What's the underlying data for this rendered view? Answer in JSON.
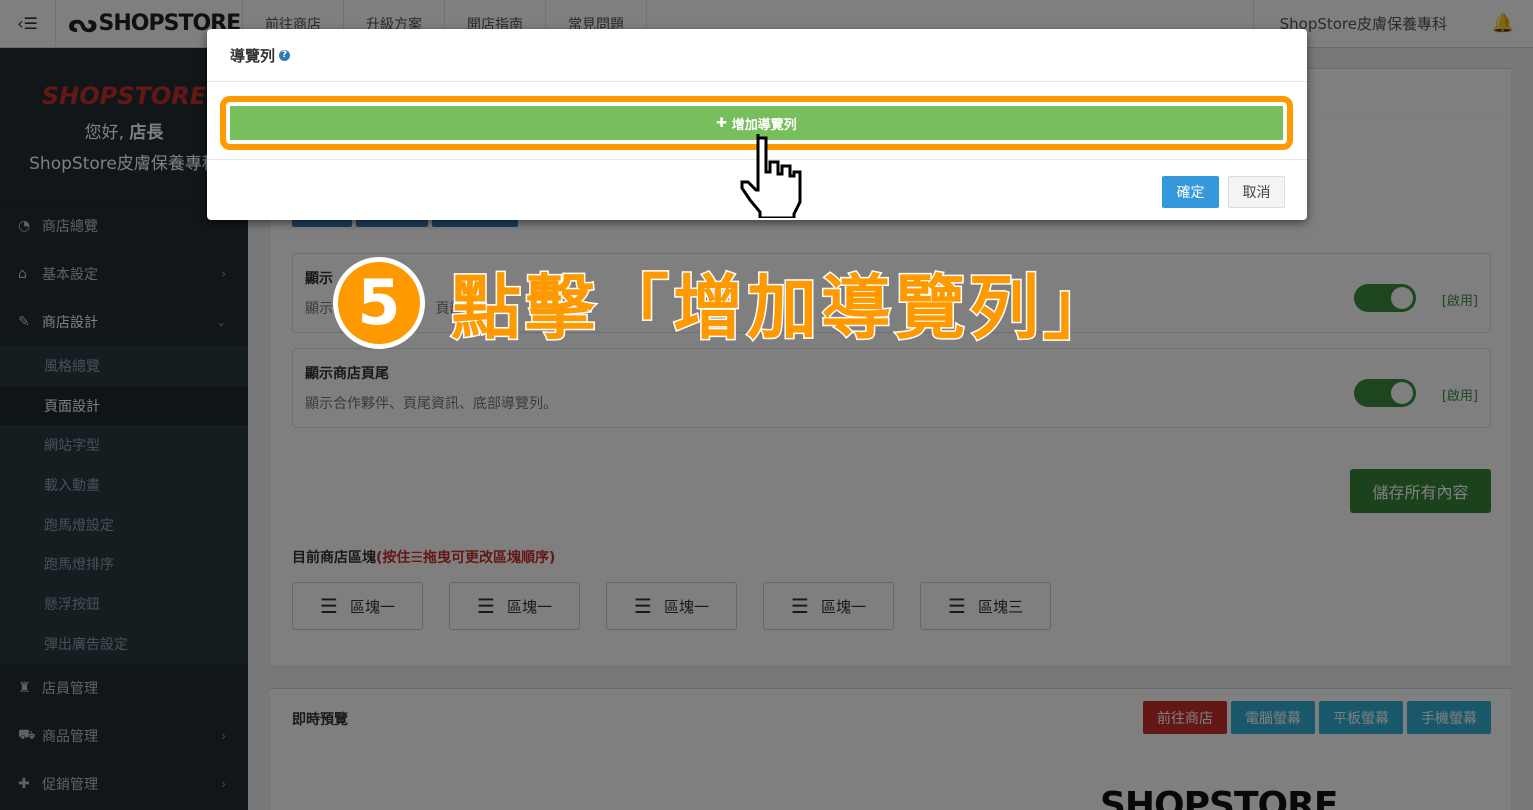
{
  "topbar": {
    "logo_text": "SHOPSTORE",
    "nav": [
      "前往商店",
      "升級方案",
      "開店指南",
      "常見問題"
    ],
    "store_name": "ShopStore皮膚保養專科"
  },
  "sidebar": {
    "brand_logo": "SHOPSTORE",
    "hello_prefix": "您好,",
    "hello_name": "店長",
    "store": "ShopStore皮膚保養專科",
    "menu": [
      {
        "label": "商店總覽",
        "icon": "dashboard-icon"
      },
      {
        "label": "基本設定",
        "icon": "bank-icon"
      },
      {
        "label": "商店設計",
        "icon": "magic-wand-icon"
      }
    ],
    "submenu": [
      "風格總覽",
      "頁面設計",
      "網站字型",
      "載入動畫",
      "跑馬燈設定",
      "跑馬燈排序",
      "懸浮按鈕",
      "彈出廣告設定"
    ],
    "menu_bottom": [
      {
        "label": "店員管理",
        "icon": "user-lock-icon"
      },
      {
        "label": "商品管理",
        "icon": "cart-icon"
      },
      {
        "label": "促銷管理",
        "icon": "gift-icon"
      }
    ]
  },
  "content": {
    "settings": [
      {
        "title": "顯示",
        "desc": "顯示",
        "desc_tail": "頁部",
        "state": "[啟用]"
      },
      {
        "title": "顯示商店頁尾",
        "desc": "顯示合作夥伴、頁尾資訊、底部導覽列。",
        "state": "[啟用]"
      }
    ],
    "save_label": "儲存所有內容",
    "blocks_title": "目前商店區塊",
    "blocks_hint": "(按住☰拖曳可更改區塊順序)",
    "blocks": [
      "區塊一",
      "區塊一",
      "區塊一",
      "區塊一",
      "區塊三"
    ],
    "preview_title": "即時預覽",
    "preview_buttons": [
      "前往商店",
      "電腦螢幕",
      "平板螢幕",
      "手機螢幕"
    ],
    "preview_logo": "SHOPSTORE"
  },
  "modal": {
    "title": "導覽列",
    "add_label": "增加導覽列",
    "ok_label": "確定",
    "cancel_label": "取消"
  },
  "annotation": {
    "step_number": "5",
    "text": "點擊「增加導覽列」"
  },
  "colors": {
    "accent_orange": "#ff9900",
    "add_green": "#77bf5c",
    "ok_blue": "#3498db",
    "sidebar_bg": "#222d32"
  }
}
